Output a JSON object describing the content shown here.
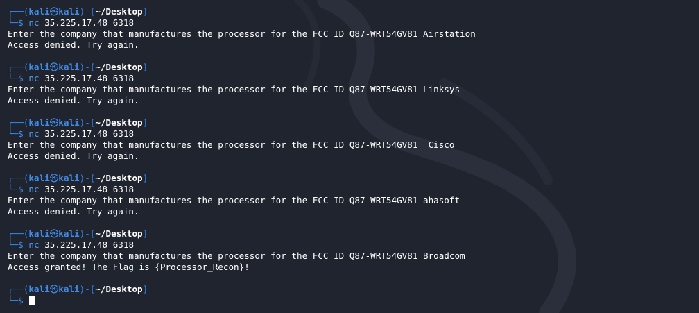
{
  "prompt": {
    "user": "kali",
    "at_symbol": "㉿",
    "host": "kali",
    "path": "~/Desktop",
    "frame_top": "┌──(",
    "frame_mid": ")-[",
    "frame_end": "]",
    "frame_bottom": "└─",
    "dollar": "$"
  },
  "sessions": [
    {
      "command": "nc",
      "args": "35.225.17.48 6318",
      "output": [
        "Enter the company that manufactures the processor for the FCC ID Q87-WRT54GV81 Airstation",
        "Access denied. Try again."
      ]
    },
    {
      "command": "nc",
      "args": "35.225.17.48 6318",
      "output": [
        "Enter the company that manufactures the processor for the FCC ID Q87-WRT54GV81 Linksys",
        "Access denied. Try again."
      ]
    },
    {
      "command": "nc",
      "args": "35.225.17.48 6318",
      "output": [
        "Enter the company that manufactures the processor for the FCC ID Q87-WRT54GV81  Cisco",
        "Access denied. Try again."
      ]
    },
    {
      "command": "nc",
      "args": "35.225.17.48 6318",
      "output": [
        "Enter the company that manufactures the processor for the FCC ID Q87-WRT54GV81 ahasoft",
        "Access denied. Try again."
      ]
    },
    {
      "command": "nc",
      "args": "35.225.17.48 6318",
      "output": [
        "Enter the company that manufactures the processor for the FCC ID Q87-WRT54GV81 Broadcom",
        "Access granted! The Flag is {Processor_Recon}!"
      ]
    }
  ],
  "colors": {
    "background": "#20242f",
    "prompt_blue": "#3f8be6",
    "text": "#ffffff"
  }
}
